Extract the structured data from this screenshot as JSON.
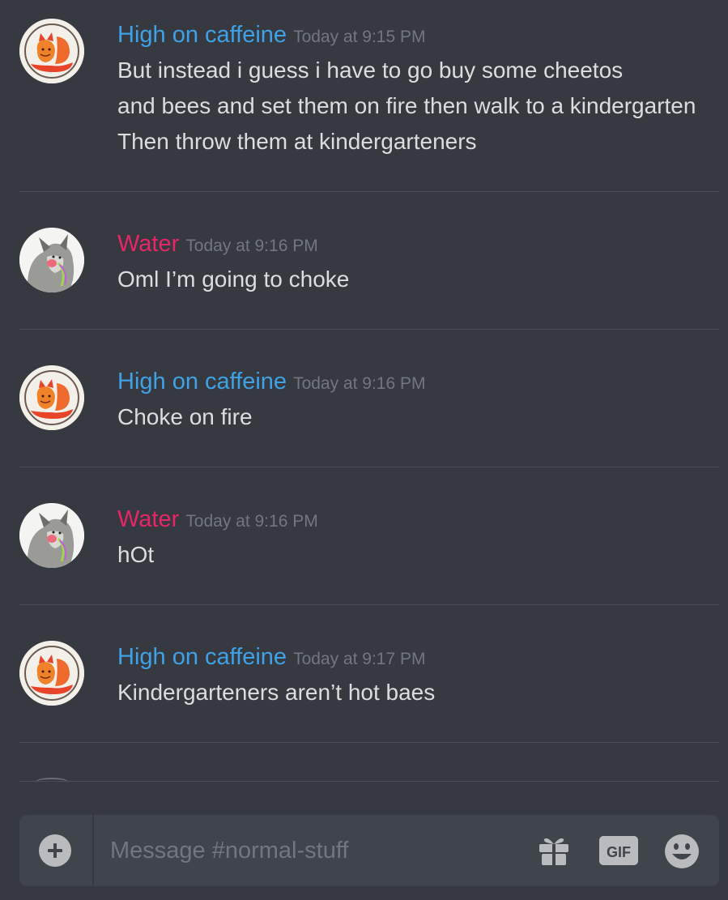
{
  "messages": [
    {
      "author": "High on caffeine",
      "author_color": "#3fa1e6",
      "avatar": "fox-avatar",
      "timestamp": "Today at 9:15 PM",
      "lines": [
        "But instead i guess i have to go buy some cheetos",
        "and bees and set them on fire then walk to a kindergarten",
        "Then throw them at kindergarteners"
      ]
    },
    {
      "author": "Water",
      "author_color": "#e8256a",
      "avatar": "wolf-avatar",
      "timestamp": "Today at 9:16 PM",
      "lines": [
        "Oml I’m going to choke"
      ]
    },
    {
      "author": "High on caffeine",
      "author_color": "#3fa1e6",
      "avatar": "fox-avatar",
      "timestamp": "Today at 9:16 PM",
      "lines": [
        "Choke on fire"
      ]
    },
    {
      "author": "Water",
      "author_color": "#e8256a",
      "avatar": "wolf-avatar",
      "timestamp": "Today at 9:16 PM",
      "lines": [
        "hOt"
      ]
    },
    {
      "author": "High on caffeine",
      "author_color": "#3fa1e6",
      "avatar": "fox-avatar",
      "timestamp": "Today at 9:17 PM",
      "lines": [
        "Kindergarteners aren’t hot baes"
      ]
    }
  ],
  "composer": {
    "placeholder": "Message #normal-stuff",
    "gif_label": "GIF",
    "icons": [
      "add-icon",
      "gift-icon",
      "gif-icon",
      "emoji-icon"
    ]
  },
  "colors": {
    "background": "#36393f",
    "composer": "#40444b",
    "text": "#dcddde",
    "timestamp": "#72767d"
  }
}
